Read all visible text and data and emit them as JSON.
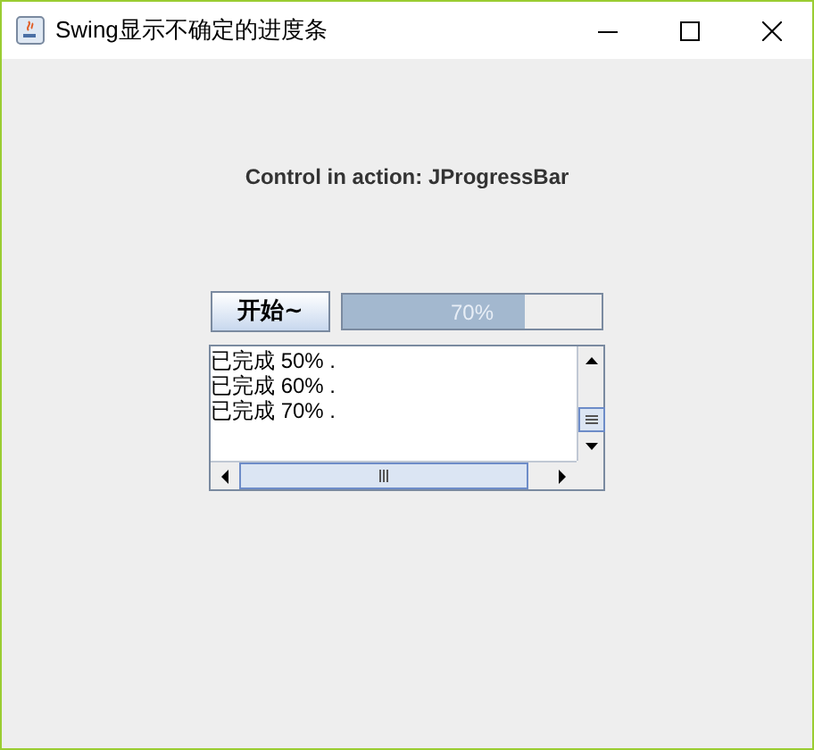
{
  "window": {
    "title": "Swing显示不确定的进度条"
  },
  "label": "Control in action: JProgressBar",
  "start_button": {
    "label": "开始~"
  },
  "progress": {
    "level": 0.7,
    "text": "70%"
  },
  "log": {
    "lines": [
      "已完成 50% .",
      "已完成 60% .",
      "已完成 70% ."
    ]
  }
}
